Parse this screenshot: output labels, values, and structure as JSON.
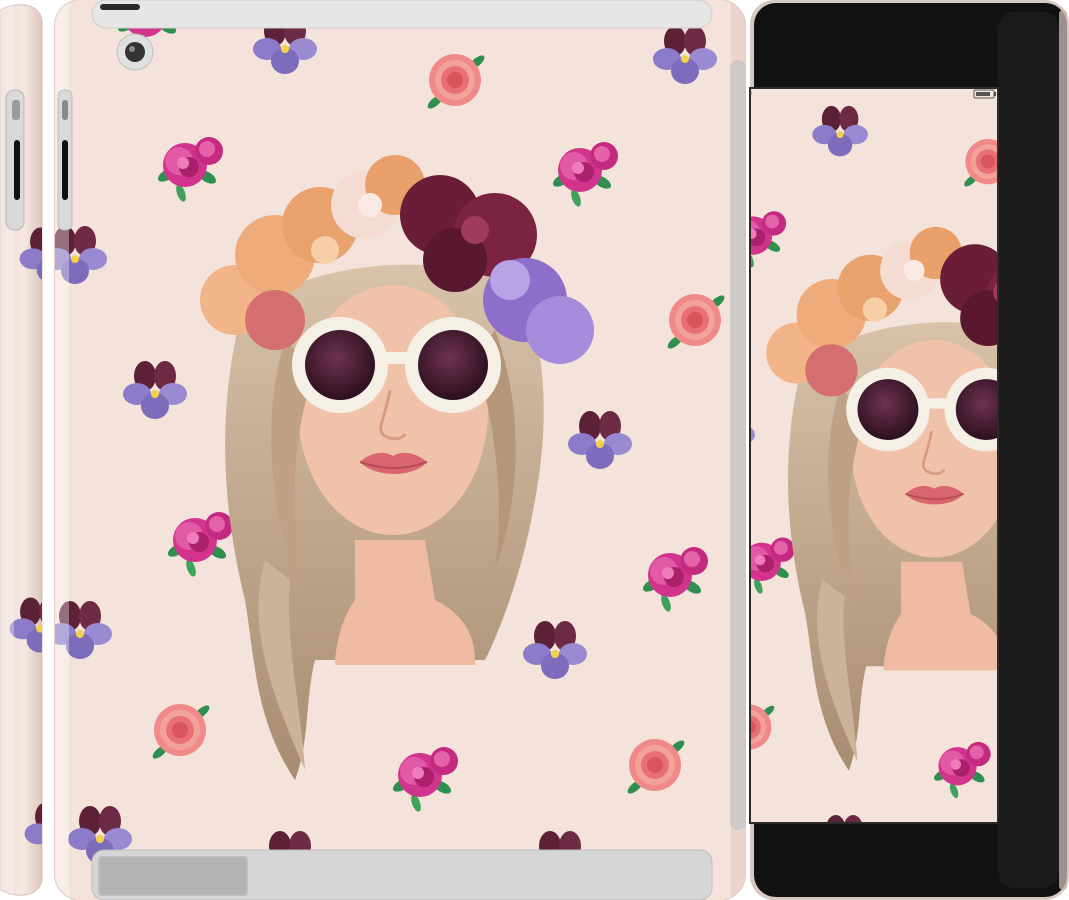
{
  "product": {
    "views": [
      "side",
      "back",
      "front"
    ],
    "case_design": "flowers-girl-in-sunglasses"
  },
  "colors": {
    "case_background": "#f4e3db",
    "case_edge": "#e8cfc7",
    "device_black": "#111111",
    "bezel_gray": "#9a9a9a",
    "speaker_gray": "#bdbdbd",
    "rose_pink": "#d2338c",
    "rose_dark": "#8c1d55",
    "pansy_purple": "#8c7bc8",
    "pansy_dark": "#5c2037",
    "dahlia_coral": "#f08a8a",
    "leaf_green": "#2f8f4f",
    "hair_blonde": "#c8ad92",
    "skin": "#f1c2aa",
    "sunglasses_frame": "#f4f0e6",
    "lens": "#4a1e34",
    "lips": "#d9666f"
  },
  "icons": [
    "camera-lens-icon",
    "speaker-grille-icon",
    "status-bar-icon"
  ]
}
